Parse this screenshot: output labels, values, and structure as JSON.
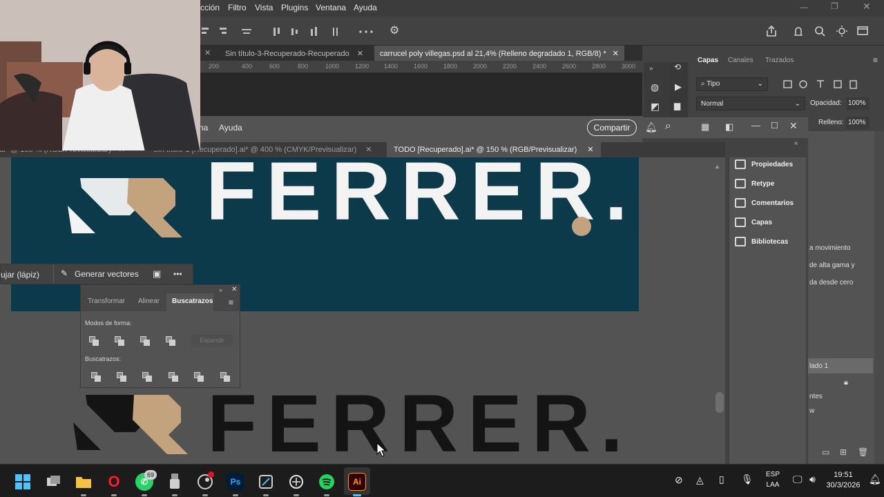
{
  "photoshop": {
    "menu": [
      "cción",
      "Filtro",
      "Vista",
      "Plugins",
      "Ventana",
      "Ayuda"
    ],
    "tabs": [
      {
        "label": "Sin título-3-Recuperado-Recuperado",
        "active": false
      },
      {
        "label": "carrucel poly villegas.psd al 21,4% (Relleno degradado 1, RGB/8) *",
        "active": true
      }
    ],
    "ruler_ticks": [
      "200",
      "400",
      "600",
      "800",
      "1000",
      "1200",
      "1400",
      "1600",
      "1800",
      "2000",
      "2200",
      "2400",
      "2600",
      "2800",
      "3000"
    ],
    "panel_tabs": [
      "Capas",
      "Canales",
      "Trazados"
    ],
    "layer_filter": "Tipo",
    "blend_mode": "Normal",
    "opacity_label": "Opacidad:",
    "opacity_value": "100%",
    "fill_label": "Relleno:",
    "fill_value": "100%",
    "layer_texts": [
      "a movimiento",
      "de alta gama y",
      "da desde cero",
      "lado 1",
      "ntes",
      "w"
    ]
  },
  "illustrator": {
    "menu": [
      "na",
      "Ayuda"
    ],
    "share_button": "Compartir",
    "tabs": [
      {
        "label": "o.ai* @ 150 % (RGB/Previsualizar)",
        "active": false
      },
      {
        "label": "Sin título-1 [Recuperado].ai* @ 400 % (CMYK/Previsualizar)",
        "active": false
      },
      {
        "label": "TODO [Recuperado].ai* @ 150 % (RGB/Previsualizar)",
        "active": true
      }
    ],
    "logo_word": "FERRER.",
    "logo_mark": "ƧR",
    "logo_colors": {
      "dark_bg": "#0c3a4a",
      "light": "#f3f3f3",
      "accent": "#c3a27e",
      "dark": "#141414"
    },
    "context_toolbar": {
      "draw_label": "ujar (lápiz)",
      "vectors_label": "Generar vectores",
      "more": "•••"
    },
    "pathfinder": {
      "tabs": [
        "Transformar",
        "Alinear",
        "Buscatrazos"
      ],
      "active_tab": "Buscatrazos",
      "shape_modes_label": "Modos de forma:",
      "expand_label": "Expandir",
      "pathfinders_label": "Buscatrazos:"
    },
    "dock": [
      "Propiedades",
      "Retype",
      "Comentarios",
      "Capas",
      "Bibliotecas"
    ]
  },
  "taskbar": {
    "apps": [
      {
        "name": "start",
        "label": ""
      },
      {
        "name": "task-view",
        "label": ""
      },
      {
        "name": "file-explorer",
        "label": ""
      },
      {
        "name": "opera",
        "label": "O"
      },
      {
        "name": "whatsapp",
        "label": "",
        "badge": "69"
      },
      {
        "name": "app-5",
        "label": ""
      },
      {
        "name": "app-6",
        "label": ""
      },
      {
        "name": "photoshop",
        "label": "Ps"
      },
      {
        "name": "app-8",
        "label": ""
      },
      {
        "name": "chatgpt",
        "label": ""
      },
      {
        "name": "spotify",
        "label": ""
      },
      {
        "name": "illustrator",
        "label": "Ai"
      }
    ],
    "lang_top": "ESP",
    "lang_bottom": "LAA",
    "time": "19:51",
    "date": "30/3/2026"
  }
}
